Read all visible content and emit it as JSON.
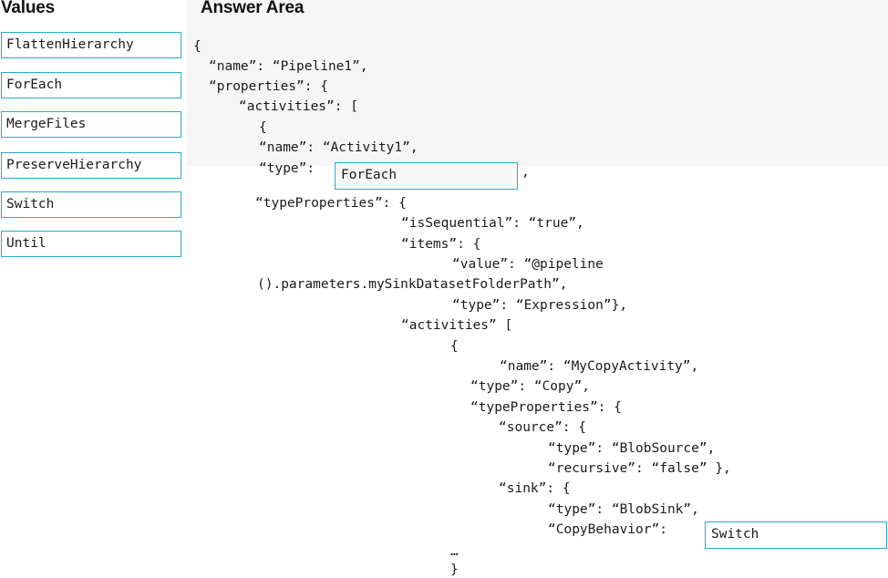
{
  "values_panel": {
    "heading": "Values",
    "options": [
      "FlattenHierarchy",
      "ForEach",
      "MergeFiles",
      "PreserveHierarchy",
      "Switch",
      "Until"
    ]
  },
  "answer_area": {
    "heading": "Answer Area",
    "code_lines": [
      "{",
      "“name”: “Pipeline1”,",
      "“properties”: {",
      "“activities”: [",
      "{",
      "“name”: “Activity1”,",
      "“type”:",
      ",",
      "“typeProperties”: {",
      "“isSequential”: “true”,",
      "“items”: {",
      "“value”: “@pipeline",
      "().parameters.mySinkDatasetFolderPath”,",
      "“type”: “Expression”},",
      "“activities” [",
      "{",
      "“name”: “MyCopyActivity”,",
      "“type”: “Copy”,",
      "“typeProperties”: {",
      "“source”: {",
      "“type”: “BlobSource”,",
      "“recursive”: “false” },",
      "“sink”: {",
      "“type”: “BlobSink”,",
      "“CopyBehavior”:",
      "…",
      "}"
    ],
    "drop_targets": {
      "activity_type": "ForEach",
      "copy_behavior": "Switch"
    }
  }
}
